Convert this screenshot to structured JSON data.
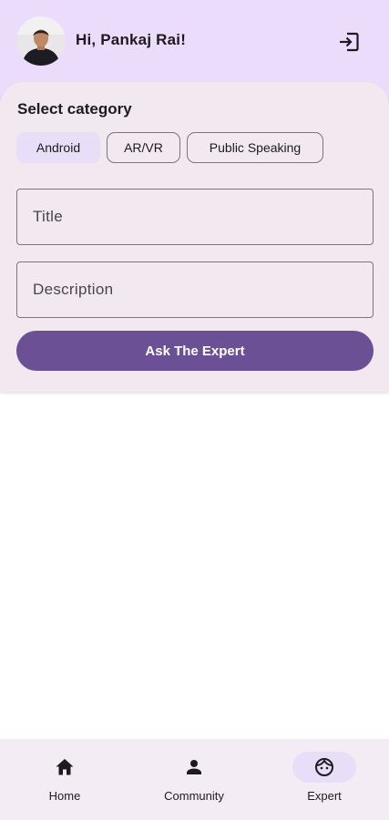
{
  "header": {
    "greeting": "Hi, Pankaj Rai!",
    "avatar_icon": "user-photo",
    "logout_icon": "logout-icon"
  },
  "form": {
    "section_title": "Select category",
    "categories": [
      {
        "label": "Android",
        "selected": true
      },
      {
        "label": "AR/VR",
        "selected": false
      },
      {
        "label": "Public Speaking",
        "selected": false
      }
    ],
    "title_placeholder": "Title",
    "description_placeholder": "Description",
    "submit_label": "Ask The Expert"
  },
  "bottom_nav": {
    "items": [
      {
        "label": "Home",
        "icon": "home-icon",
        "active": false
      },
      {
        "label": "Community",
        "icon": "person-icon",
        "active": false
      },
      {
        "label": "Expert",
        "icon": "face-icon",
        "active": true
      }
    ]
  },
  "colors": {
    "header_bg": "#ebdcfc",
    "card_bg": "#f1e8f0",
    "primary": "#6c5096",
    "selected_chip": "#e8def7",
    "nav_bg": "#f3ecf4"
  }
}
